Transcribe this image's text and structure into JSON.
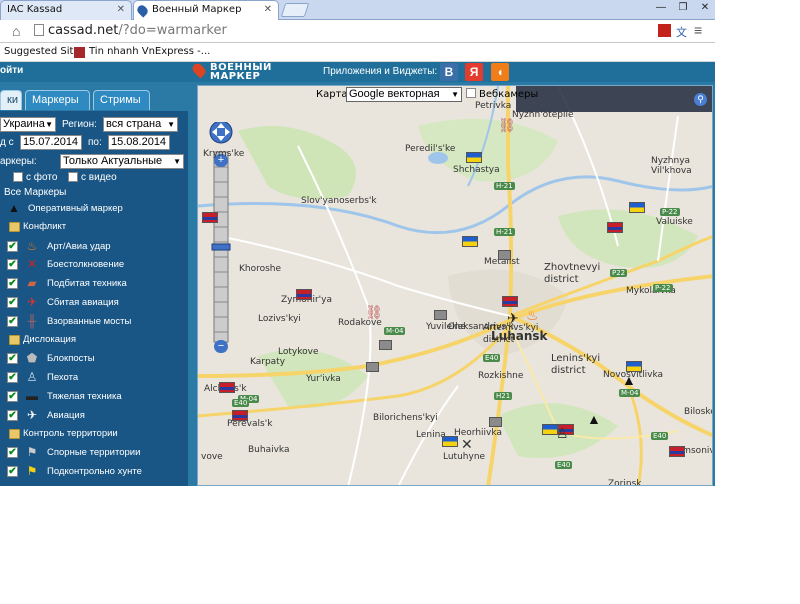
{
  "browser": {
    "tabs": [
      {
        "label": "IAC Kassad",
        "active": false
      },
      {
        "label": "Военный Маркер",
        "active": true
      }
    ],
    "url_host": "cassad.net",
    "url_path": "/?do=warmarker",
    "bookmarks": [
      "Suggested Sites",
      "Tin nhanh VnExpress -..."
    ]
  },
  "site": {
    "login_label": "ойти",
    "logo_line1": "ВОЕННЫЙ",
    "logo_line2": "МАРКЕР",
    "apps_label": "Приложения и Виджеты:",
    "social": [
      {
        "label": "B",
        "color": "#3b6fa8"
      },
      {
        "label": "Я",
        "color": "#e33b2e"
      },
      {
        "label": "◖",
        "color": "#f07d18"
      }
    ]
  },
  "panel": {
    "tabs": [
      "ки",
      "Маркеры",
      "Стримы"
    ],
    "country_value": "Украина",
    "region_label": "Регион:",
    "region_value": "вся страна",
    "date_from_label": "д с",
    "date_from": "15.07.2014",
    "date_to_label": "по:",
    "date_to": "15.08.2014",
    "markers_label": "аркеры:",
    "markers_value": "Только Актуальные",
    "photo_label": "с фото",
    "video_label": "с видео",
    "all_markers": "Все Маркеры",
    "items": [
      {
        "kind": "item",
        "label": "Оперативный маркер",
        "icon": "warning-icon",
        "checked": false
      },
      {
        "kind": "folder",
        "label": "Конфликт"
      },
      {
        "kind": "item",
        "label": "Арт/Авиа удар",
        "icon": "fire-icon",
        "checked": true
      },
      {
        "kind": "item",
        "label": "Боестолкновение",
        "icon": "crossed-swords-icon",
        "checked": true
      },
      {
        "kind": "item",
        "label": "Подбитая техника",
        "icon": "burning-tank-icon",
        "checked": true
      },
      {
        "kind": "item",
        "label": "Сбитая авиация",
        "icon": "downed-plane-icon",
        "checked": true
      },
      {
        "kind": "item",
        "label": "Взорванные мосты",
        "icon": "bridge-icon",
        "checked": true
      },
      {
        "kind": "folder",
        "label": "Дислокация"
      },
      {
        "kind": "item",
        "label": "Блокпосты",
        "icon": "shield-icon",
        "checked": true
      },
      {
        "kind": "item",
        "label": "Пехота",
        "icon": "soldier-icon",
        "checked": true
      },
      {
        "kind": "item",
        "label": "Тяжелая техника",
        "icon": "tank-icon",
        "checked": true
      },
      {
        "kind": "item",
        "label": "Авиация",
        "icon": "plane-icon",
        "checked": true
      },
      {
        "kind": "folder",
        "label": "Контроль территории"
      },
      {
        "kind": "item",
        "label": "Спорные территории",
        "icon": "grey-flag-icon",
        "checked": true
      },
      {
        "kind": "item",
        "label": "Подконтрольно хунте",
        "icon": "ua-flag-icon",
        "checked": true
      }
    ]
  },
  "map": {
    "type_label": "Карта:",
    "type_value": "Google векторная",
    "webcams_label": "Вебкамеры",
    "places": [
      "Petrivka",
      "Nyzhn'otepile",
      "Peredil's'ke",
      "Shchastya",
      "Kryms'ke",
      "Slov'yanoserbs'k",
      "Nyzhnya",
      "Vil'khova",
      "Valuiske",
      "Metalist",
      "Zhovtnevyi",
      "district",
      "Khoroshe",
      "Mykolaivka",
      "Zymohir'ya",
      "Oleksandrivs'k",
      "Luhansk",
      "Artemivs'kyi",
      "district",
      "Lozivs'kyi",
      "Rodakove",
      "Yuvileine",
      "Lenins'kyi",
      "district",
      "Lotykove",
      "Karpaty",
      "Yur'ivka",
      "Rozkishne",
      "Novosvitlivka",
      "Alchevs'k",
      "Perevals'k",
      "Bilorichens'kyi",
      "Biloske",
      "Buhaivka",
      "Lenina",
      "Heorhiivka",
      "Lutuhyne",
      "Samsonivka",
      "vove",
      "Zorinsk"
    ],
    "roads": [
      "H-21",
      "H-21",
      "P-22",
      "P22",
      "P-22",
      "M-04",
      "M-04",
      "E40",
      "E40",
      "H21",
      "M-04",
      "E40",
      "E40"
    ]
  }
}
